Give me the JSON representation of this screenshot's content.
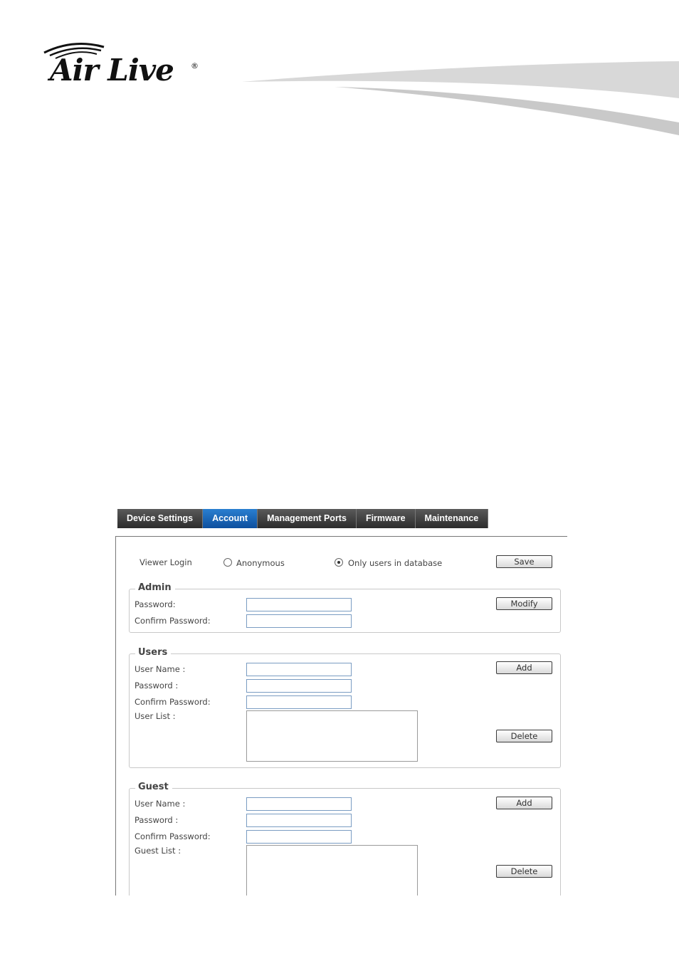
{
  "brand": {
    "logo_text": "Air Live",
    "registered_mark": "®"
  },
  "tabs": [
    {
      "label": "Device Settings"
    },
    {
      "label": "Account"
    },
    {
      "label": "Management Ports"
    },
    {
      "label": "Firmware"
    },
    {
      "label": "Maintenance"
    }
  ],
  "active_tab": "Account",
  "viewer": {
    "label": "Viewer Login",
    "option_anonymous": "Anonymous",
    "option_database": "Only users in database",
    "selected": "Only users in database",
    "save_label": "Save"
  },
  "admin": {
    "legend": "Admin",
    "password_label": "Password:",
    "password_value": "",
    "confirm_label": "Confirm Password:",
    "confirm_value": "",
    "modify_label": "Modify"
  },
  "users": {
    "legend": "Users",
    "username_label": "User Name :",
    "username_value": "",
    "password_label": "Password :",
    "password_value": "",
    "confirm_label": "Confirm Password:",
    "confirm_value": "",
    "list_label": "User List :",
    "list_items": [],
    "add_label": "Add",
    "delete_label": "Delete"
  },
  "guest": {
    "legend": "Guest",
    "username_label": "User Name :",
    "username_value": "",
    "password_label": "Password :",
    "password_value": "",
    "confirm_label": "Confirm Password:",
    "confirm_value": "",
    "list_label": "Guest List :",
    "list_items": [],
    "add_label": "Add",
    "delete_label": "Delete"
  }
}
